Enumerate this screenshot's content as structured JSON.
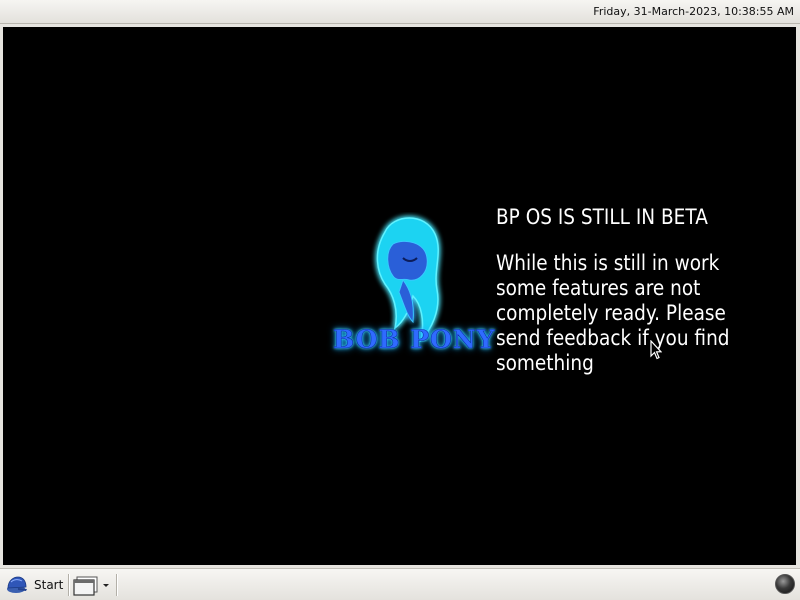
{
  "topbar": {
    "clock": "Friday, 31-March-2023, 10:38:55 AM"
  },
  "desktop": {
    "logo": {
      "text": "BOB PONY",
      "icon": "pony-silhouette-logo"
    },
    "notice": {
      "title": "BP OS IS STILL IN BETA",
      "lines": [
        "While this is still in work",
        "some features are not",
        "completely ready. Please",
        "send feedback if you find",
        "something"
      ]
    }
  },
  "taskbar": {
    "start_label": "Start",
    "start_icon": "blue-cap-icon",
    "window_switcher_icon": "windows-stack-icon",
    "status_icon": "status-orb-icon"
  },
  "colors": {
    "desktop_background": "#000000",
    "logo_glow": "#24c9ff",
    "logo_text": "#2f6bff",
    "panel": "#e4e2dd"
  }
}
